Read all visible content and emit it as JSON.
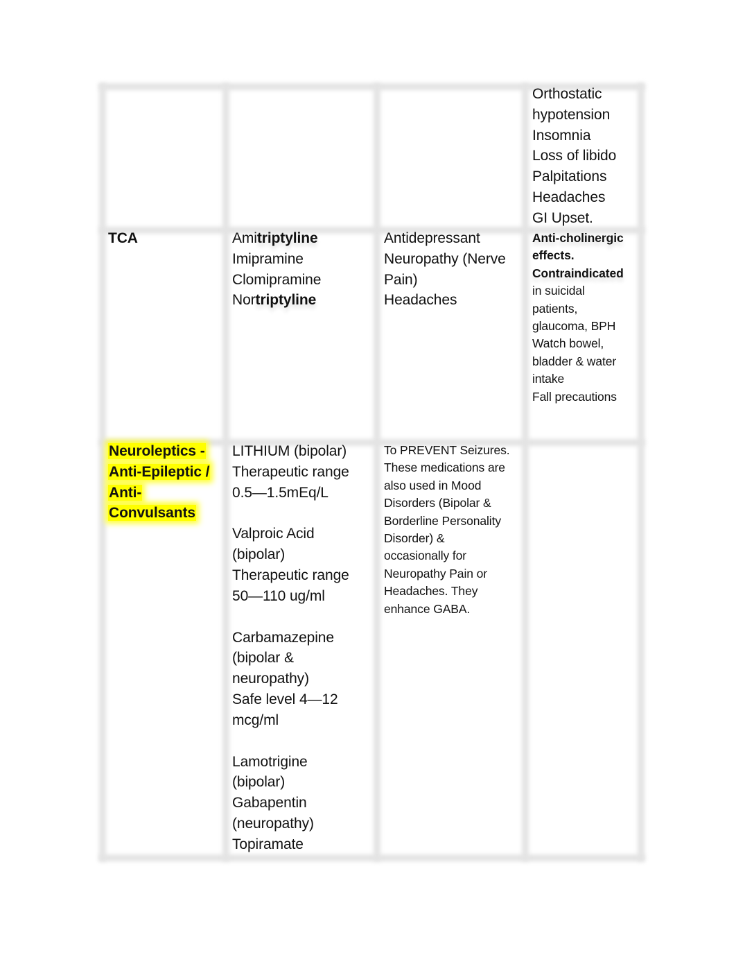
{
  "document": {
    "table": {
      "columns": 4,
      "rows": [
        {
          "class": "",
          "drugs": [],
          "uses": [],
          "notes": [
            {
              "text": "Orthostatic",
              "bold": false
            },
            {
              "text": "hypotension",
              "bold": false
            },
            {
              "text": "Insomnia",
              "bold": false
            },
            {
              "text": "Loss of libido",
              "bold": false
            },
            {
              "text": "Palpitations",
              "bold": false
            },
            {
              "text": "Headaches",
              "bold": false
            },
            {
              "text": "GI Upset.",
              "bold": false
            }
          ]
        },
        {
          "class": "TCA",
          "drugs": [
            {
              "prefix": "Ami",
              "bold_suffix": "triptyline"
            },
            {
              "prefix": "Imipramine",
              "bold_suffix": ""
            },
            {
              "prefix": "Clomipramine",
              "bold_suffix": ""
            },
            {
              "prefix": "Nor",
              "bold_suffix": "triptyline"
            }
          ],
          "uses": [
            "Antidepressant",
            "Neuropathy (Nerve",
            "Pain)",
            "Headaches"
          ],
          "notes": [
            {
              "text": "Anti-cholinergic",
              "bold": true
            },
            {
              "text": "effects.",
              "bold": true
            },
            {
              "text": "Contraindicated",
              "bold": true
            },
            {
              "text": "in suicidal",
              "bold": false
            },
            {
              "text": "patients,",
              "bold": false
            },
            {
              "text": "glaucoma, BPH",
              "bold": false
            },
            {
              "text": "Watch bowel,",
              "bold": false
            },
            {
              "text": "bladder & water",
              "bold": false
            },
            {
              "text": "intake",
              "bold": false
            },
            {
              "text": "Fall precautions",
              "bold": false
            }
          ]
        },
        {
          "class_lines": [
            "Neuroleptics -",
            "Anti-Epileptic /",
            "Anti-",
            "Convulsants"
          ],
          "class_highlight_color": "#ffff00",
          "drug_groups": [
            [
              "LITHIUM (bipolar)",
              "Therapeutic range",
              "0.5—1.5mEq/L"
            ],
            [
              "Valproic Acid",
              "(bipolar)",
              "Therapeutic range",
              "50—110 ug/ml"
            ],
            [
              "Carbamazepine",
              "(bipolar &",
              "neuropathy)",
              "Safe level 4—12",
              "mcg/ml"
            ],
            [
              "Lamotrigine",
              "(bipolar)",
              "Gabapentin",
              "(neuropathy)",
              "Topiramate"
            ]
          ],
          "uses": [
            "To PREVENT Seizures.",
            "These medications are",
            "also used in Mood",
            "Disorders (Bipolar &",
            "Borderline Personality",
            "Disorder) &",
            "occasionally for",
            "Neuropathy Pain or",
            "Headaches. They",
            "enhance GABA."
          ],
          "notes": []
        }
      ]
    }
  }
}
